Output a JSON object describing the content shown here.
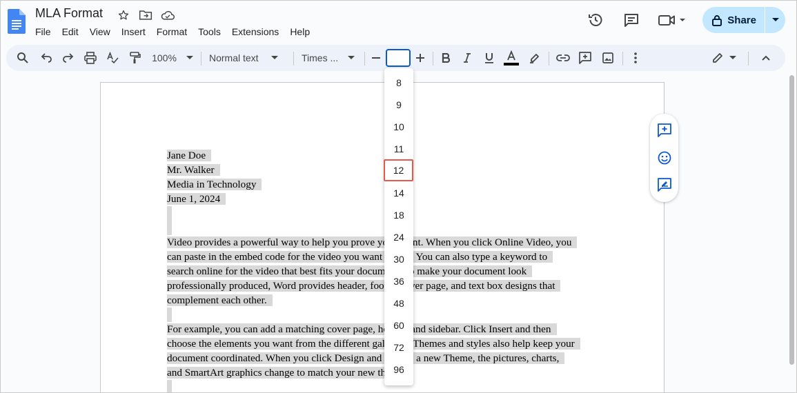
{
  "app": {
    "title": "MLA Format",
    "icons": [
      "docs-logo-icon",
      "star-icon",
      "move-folder-icon",
      "cloud-saved-icon"
    ]
  },
  "menu": [
    "File",
    "Edit",
    "View",
    "Insert",
    "Format",
    "Tools",
    "Extensions",
    "Help"
  ],
  "header_right": {
    "icons": [
      "version-history-icon",
      "comments-icon",
      "meet-icon"
    ],
    "share_label": "Share"
  },
  "toolbar": {
    "zoom": "100%",
    "style": "Normal text",
    "font": "Times ...",
    "font_size_value": "",
    "icons": [
      "search-icon",
      "undo-icon",
      "redo-icon",
      "print-icon",
      "spellcheck-icon",
      "paint-format-icon",
      "decrease-size-icon",
      "increase-size-icon",
      "bold-icon",
      "italic-icon",
      "underline-icon",
      "text-color-icon",
      "highlight-icon",
      "link-icon",
      "add-comment-icon",
      "insert-image-icon",
      "more-icon",
      "editing-mode-icon",
      "collapse-icon"
    ]
  },
  "font_sizes": [
    "8",
    "9",
    "10",
    "11",
    "12",
    "14",
    "18",
    "24",
    "30",
    "36",
    "48",
    "60",
    "72",
    "96"
  ],
  "selected_size": "12",
  "document": {
    "heading_lines": [
      "Jane Doe",
      "Mr. Walker",
      "Media in Technology",
      "June 1, 2024"
    ],
    "para1": [
      "Video provides a powerful way to help you prove your point. When you click Online Video, you",
      "can paste in the embed code for the video you want to add. You can also type a keyword to",
      "search online for the video that best fits your document. To make your document look",
      "professionally produced, Word provides header, footer, cover page, and text box designs that",
      "complement each other."
    ],
    "para2": [
      "For example, you can add a matching cover page, header, and sidebar. Click Insert and then",
      "choose the elements you want from the different galleries. Themes and styles also help keep your",
      "document coordinated. When you click Design and choose a new Theme, the pictures, charts,",
      "and SmartArt graphics change to match your new theme."
    ]
  },
  "side_panel_icons": [
    "add-comment-icon",
    "emoji-reaction-icon",
    "suggest-edits-icon"
  ],
  "colors": {
    "accent": "#0b57d0",
    "share_bg": "#c2e7ff",
    "toolbar_bg": "#edf2fa",
    "selection": "#d9d9d9",
    "highlight_box": "#e8584a"
  }
}
